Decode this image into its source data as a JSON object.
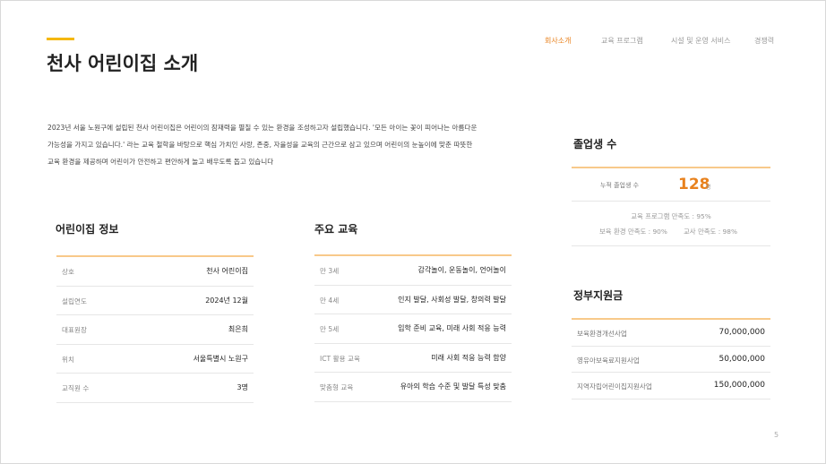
{
  "header": {
    "title": "천사 어린이집 소개",
    "nav": [
      "회사소개",
      "교육 프로그램",
      "시설 및 운영 서비스",
      "경쟁력"
    ],
    "active_nav": 0
  },
  "intro_lines": [
    "2023년 서울 노원구에 설립된 천사 어린이집은 어린이의 잠재력을 펼칠 수 있는 환경을 조성하고자 설립했습니다. '모든 아이는 꽃이 피어나는 아름다운",
    "가능성을 가지고 있습니다.' 라는 교육 철학을 바탕으로 핵심 가치인 사랑, 존중, 자율성을 교육의 근간으로 삼고 있으며 어린이의 눈높이에 맞춘 따뜻한",
    "교육 환경을 제공하며 어린이가 안전하고 편안하게 놀고 배우도록 돕고 있습니다"
  ],
  "info": {
    "heading": "어린이집 정보",
    "rows": [
      {
        "label": "상호",
        "value": "천사 어린이집"
      },
      {
        "label": "설립연도",
        "value": "2024년 12월"
      },
      {
        "label": "대표원장",
        "value": "최은희"
      },
      {
        "label": "위치",
        "value": "서울특별시 노원구"
      },
      {
        "label": "교직원 수",
        "value": "3명"
      }
    ]
  },
  "education": {
    "heading": "주요 교육",
    "rows": [
      {
        "label": "만 3세",
        "value": "감각놀이, 운동놀이, 언어놀이"
      },
      {
        "label": "만 4세",
        "value": "인지 발달, 사회성 발달, 창의력 발달"
      },
      {
        "label": "만 5세",
        "value": "입학 준비 교육, 미래 사회 적응 능력"
      },
      {
        "label": "ICT 활용 교육",
        "value": "미래 사회 적응 능력 함양"
      },
      {
        "label": "맞춤형 교육",
        "value": "유아의 학습 수준 및 발달 특성 맞춤"
      }
    ]
  },
  "graduates": {
    "heading": "졸업생 수",
    "label": "누적 졸업생 수",
    "count": "128",
    "unit": "명",
    "satisfaction_program": "교육 프로그램 만족도 : 95%",
    "satisfaction_env": "보육 환경 만족도 : 90%",
    "satisfaction_teacher": "교사 만족도 : 98%"
  },
  "subsidy": {
    "heading": "정부지원금",
    "rows": [
      {
        "label": "보육환경개선사업",
        "value": "70,000,000"
      },
      {
        "label": "영유아보육료지원사업",
        "value": "50,000,000"
      },
      {
        "label": "지역자립어린이집지원사업",
        "value": "150,000,000"
      }
    ]
  },
  "page_number": "5",
  "colors": {
    "accent": "#f5b80d",
    "active_nav": "#e8821e",
    "table_rule": "#f8c98a"
  }
}
